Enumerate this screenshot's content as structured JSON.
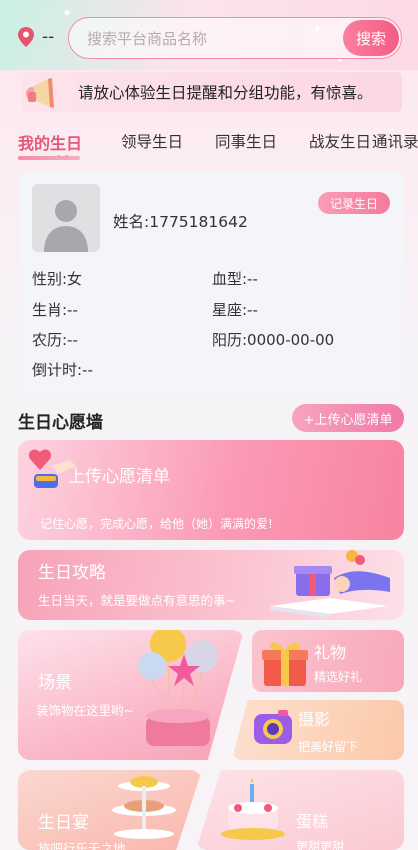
{
  "location": {
    "text": "--",
    "icon": "location-pin-icon"
  },
  "search": {
    "placeholder": "搜索平台商品名称",
    "button": "搜索"
  },
  "notice": {
    "text": "请放心体验生日提醒和分组功能，有惊喜。",
    "icon": "megaphone-icon"
  },
  "tabs": [
    {
      "label": "我的生日",
      "active": true
    },
    {
      "label": "领导生日",
      "active": false
    },
    {
      "label": "同事生日",
      "active": false
    },
    {
      "label": "战友生日",
      "active": false
    },
    {
      "label": "通讯录",
      "active": false
    }
  ],
  "profile": {
    "name": "姓名:1775181642",
    "record_button": "记录生日",
    "gender": "性别:女",
    "blood_type": "血型:--",
    "zodiac": "生肖:--",
    "constellation": "星座:--",
    "lunar": "农历:--",
    "solar": "阳历:0000-00-00",
    "countdown": "倒计时:--"
  },
  "wish_wall": {
    "title": "生日心愿墙",
    "upload_button": "+上传心愿清单",
    "card_title": "上传心愿清单",
    "card_sub": "记住心愿，完成心愿，给他（她）满满的爱!"
  },
  "guide": {
    "title": "生日攻略",
    "sub": "生日当天，就是要做点有意思的事~"
  },
  "scene": {
    "title": "场景",
    "sub": "装饰物在这里哟~"
  },
  "gift": {
    "title": "礼物",
    "sub": "精选好礼"
  },
  "photo": {
    "title": "摄影",
    "sub": "把美好留下"
  },
  "feast": {
    "title": "生日宴",
    "sub": "旅吧行乐无之地"
  },
  "cake": {
    "title": "蛋糕",
    "sub": "更甜更甜"
  },
  "colors": {
    "accent": "#f45c84",
    "active_tab": "#e45779"
  }
}
